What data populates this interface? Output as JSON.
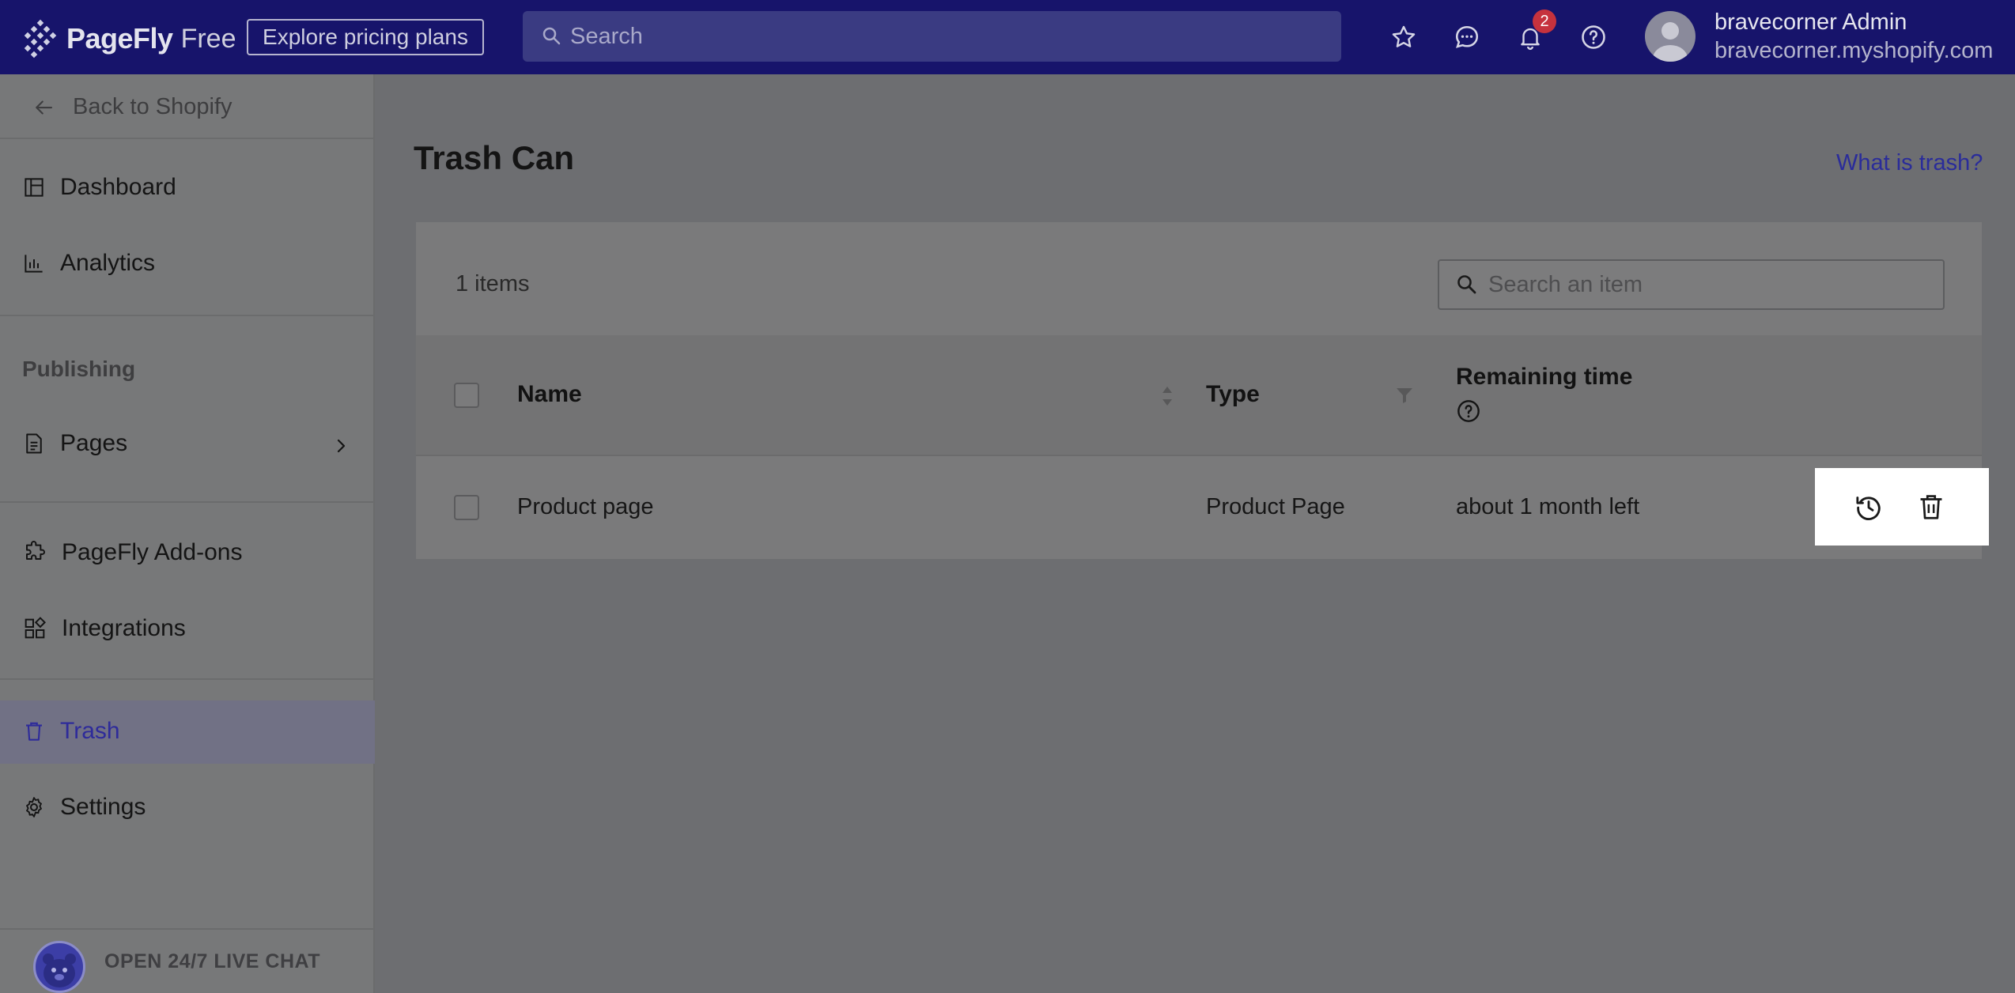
{
  "topbar": {
    "logo_name": "PageFly",
    "logo_plan": "Free",
    "pricing_button": "Explore pricing plans",
    "search_placeholder": "Search",
    "notification_count": "2",
    "user_name": "bravecorner Admin",
    "user_store": "bravecorner.myshopify.com",
    "icons": [
      "star-icon",
      "chat-icon",
      "bell-icon",
      "help-icon"
    ],
    "color": "#17146b"
  },
  "sidebar": {
    "back_label": "Back to Shopify",
    "items": [
      {
        "label": "Dashboard",
        "icon": "dashboard-icon"
      },
      {
        "label": "Analytics",
        "icon": "analytics-icon"
      },
      {
        "label": "Pages",
        "icon": "page-icon"
      },
      {
        "label": "PageFly Add-ons",
        "icon": "puzzle-icon"
      },
      {
        "label": "Integrations",
        "icon": "integrations-icon"
      },
      {
        "label": "Trash",
        "icon": "trash-icon",
        "active": true
      },
      {
        "label": "Settings",
        "icon": "gear-icon"
      }
    ],
    "section_publishing": "Publishing",
    "live_chat": "OPEN 24/7 LIVE CHAT"
  },
  "main": {
    "title": "Trash Can",
    "help_link": "What is trash?",
    "items_count": "1 items",
    "search_placeholder": "Search an item",
    "columns": {
      "name": "Name",
      "type": "Type",
      "remaining": "Remaining time"
    },
    "rows": [
      {
        "name": "Product page",
        "type": "Product Page",
        "remaining": "about 1 month left"
      }
    ],
    "link_color": "#2a2c9a"
  }
}
